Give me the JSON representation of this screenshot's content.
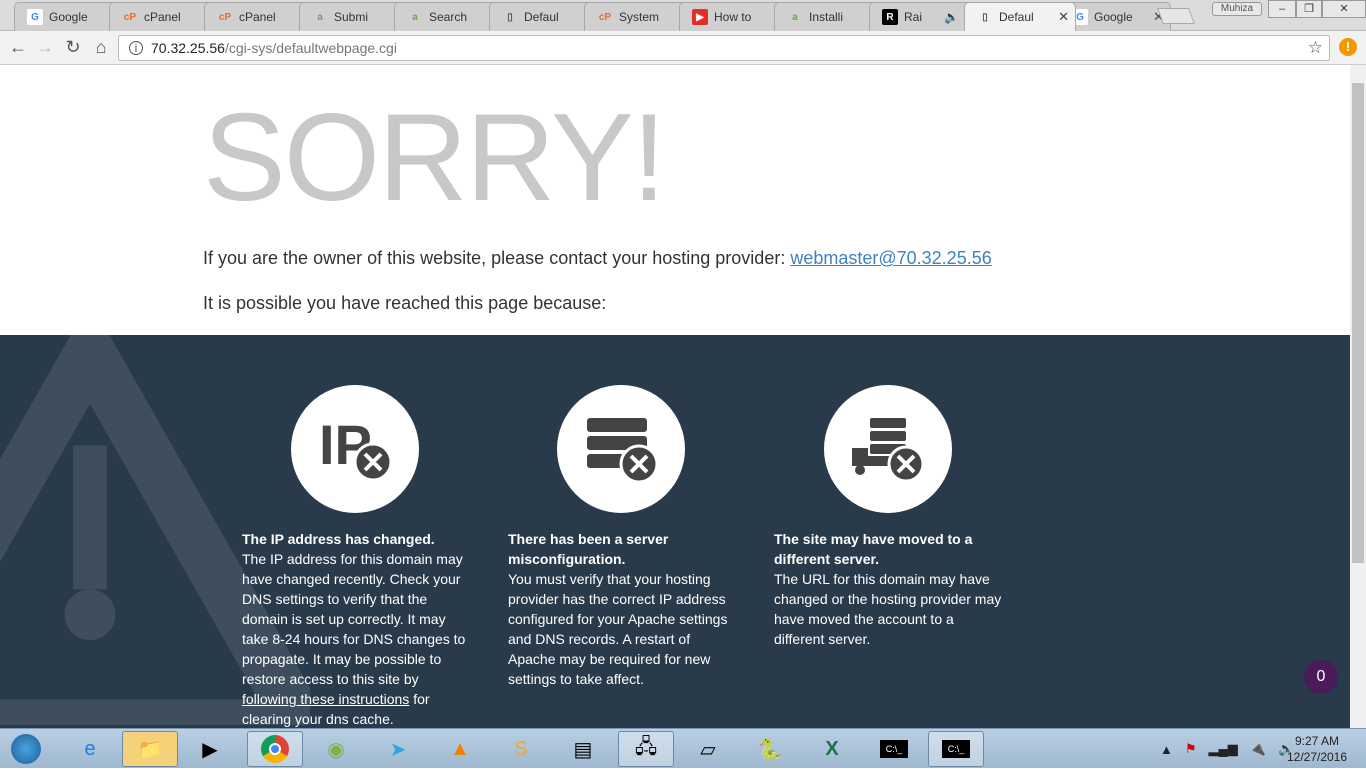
{
  "browser": {
    "tabs": [
      {
        "title": "Google",
        "icon": "google-icon"
      },
      {
        "title": "cPanel",
        "icon": "cpanel-icon"
      },
      {
        "title": "cPanel",
        "icon": "cpanel-icon"
      },
      {
        "title": "Submi",
        "icon": "app-icon"
      },
      {
        "title": "Search",
        "icon": "app-icon"
      },
      {
        "title": "Defaul",
        "icon": "page-icon"
      },
      {
        "title": "System",
        "icon": "cpanel-icon"
      },
      {
        "title": "How to",
        "icon": "youtube-icon"
      },
      {
        "title": "Installi",
        "icon": "app-icon"
      },
      {
        "title": "Rai",
        "icon": "r-icon"
      },
      {
        "title": "Defaul",
        "icon": "page-icon",
        "active": true
      },
      {
        "title": "Google",
        "icon": "google-icon"
      }
    ],
    "profile": "Muhiza",
    "url_host": "70.32.25.56",
    "url_path": "/cgi-sys/defaultwebpage.cgi"
  },
  "page": {
    "heading": "SORRY!",
    "owner_text": "If you are the owner of this website, please contact your hosting provider: ",
    "owner_email": "webmaster@70.32.25.56",
    "reason_intro": "It is possible you have reached this page because:",
    "reasons": [
      {
        "title": "The IP address has changed.",
        "body": "The IP address for this domain may have changed recently. Check your DNS settings to verify that the domain is set up correctly. It may take 8-24 hours for DNS changes to propagate. It may be possible to restore access to this site by ",
        "link": "following these instructions",
        "tail": " for clearing your dns cache."
      },
      {
        "title": "There has been a server misconfiguration.",
        "body": "You must verify that your hosting provider has the correct IP address configured for your Apache settings and DNS records. A restart of Apache may be required for new settings to take affect."
      },
      {
        "title": "The site may have moved to a different server.",
        "body": "The URL for this domain may have changed or the hosting provider may have moved the account to a different server."
      }
    ],
    "badge_count": "0"
  },
  "colors": {
    "dark_bg": "#293a4b",
    "link": "#3f82c4"
  },
  "taskbar": {
    "time": "9:27 AM",
    "date": "12/27/2016"
  }
}
